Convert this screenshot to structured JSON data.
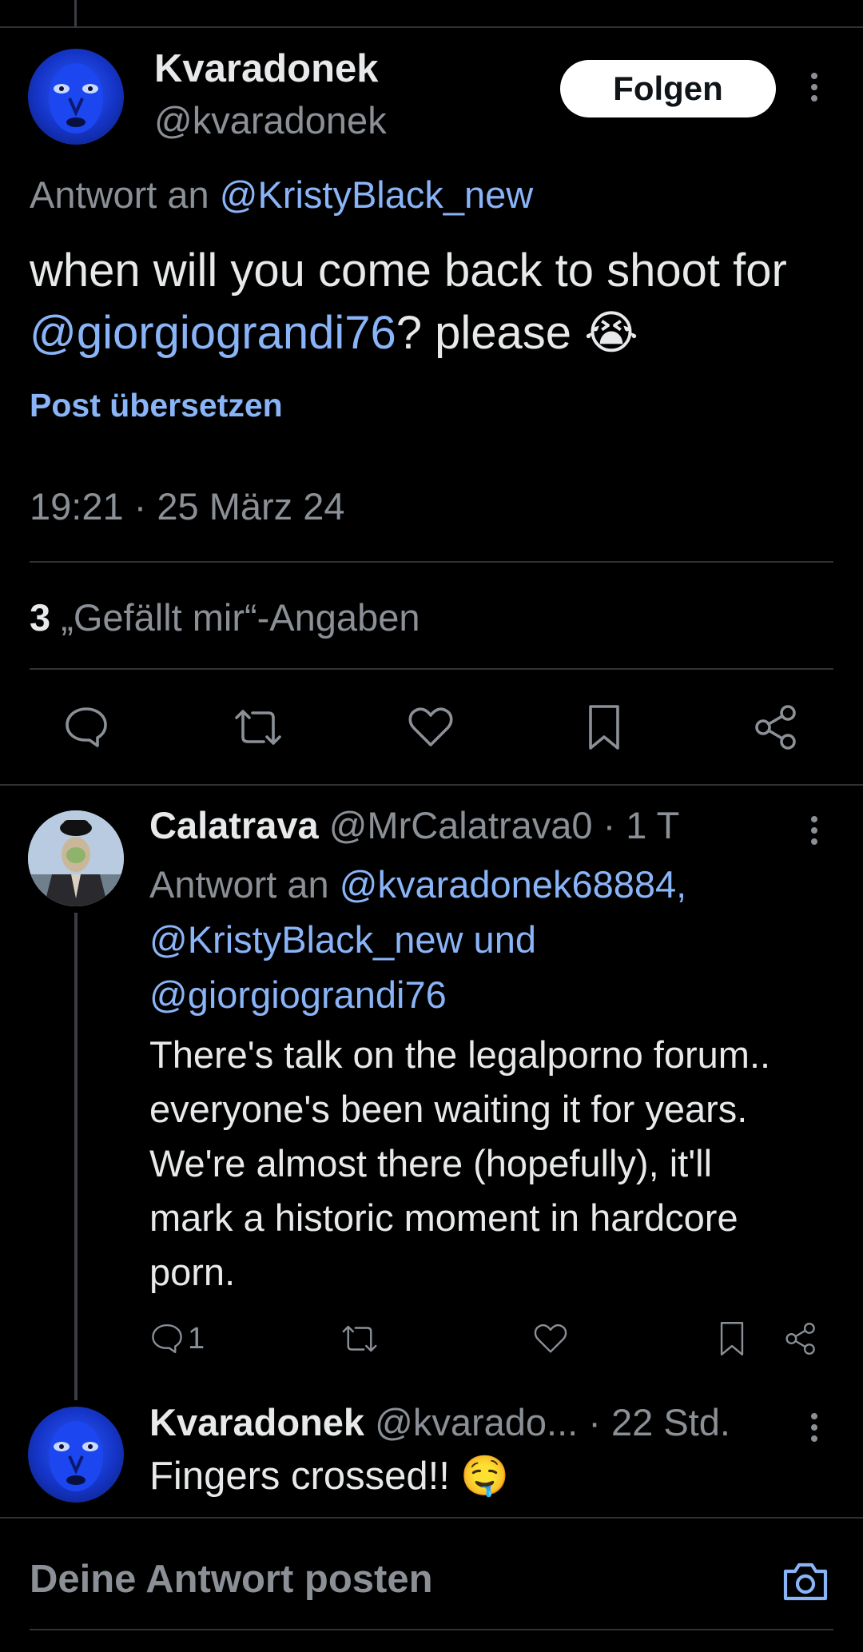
{
  "main_post": {
    "display_name": "Kvaradonek",
    "handle": "@kvaradonek",
    "follow_label": "Folgen",
    "reply_prefix": "Antwort an",
    "reply_to": "@KristyBlack_new",
    "text_part1": "when will you come back to shoot for",
    "text_mention": "@giorgiograndi76",
    "text_part2": "? please 😭",
    "translate_label": "Post übersetzen",
    "timestamp": "19:21 · 25 März 24",
    "likes_count": "3",
    "likes_label": "„Gefällt mir“-Angaben"
  },
  "reply1": {
    "display_name": "Calatrava",
    "handle": "@MrCalatrava0",
    "time": "· 1 T",
    "reply_prefix": "Antwort an",
    "mention1": "@kvaradonek68884,",
    "mention2": "@KristyBlack_new und",
    "mention3": "@giorgiograndi76",
    "text": "There's talk on the legalporno forum.. everyone's been waiting it for years. We're almost there (hopefully), it'll mark a historic moment in hardcore porn.",
    "reply_count": "1"
  },
  "reply2": {
    "display_name": "Kvaradonek",
    "handle": "@kvarado...",
    "time": "· 22 Std.",
    "text": "Fingers crossed!! 🤤"
  },
  "composer": {
    "placeholder": "Deine Antwort posten"
  },
  "icons": {
    "reply": "reply-icon",
    "repost": "repost-icon",
    "like": "heart-icon",
    "bookmark": "bookmark-icon",
    "share": "share-icon",
    "camera": "camera-icon",
    "more": "more-icon"
  },
  "colors": {
    "background": "#000000",
    "link": "#8ab4f8",
    "muted": "#8b9096",
    "text": "#e7e9ea",
    "divider": "#2f3336"
  }
}
